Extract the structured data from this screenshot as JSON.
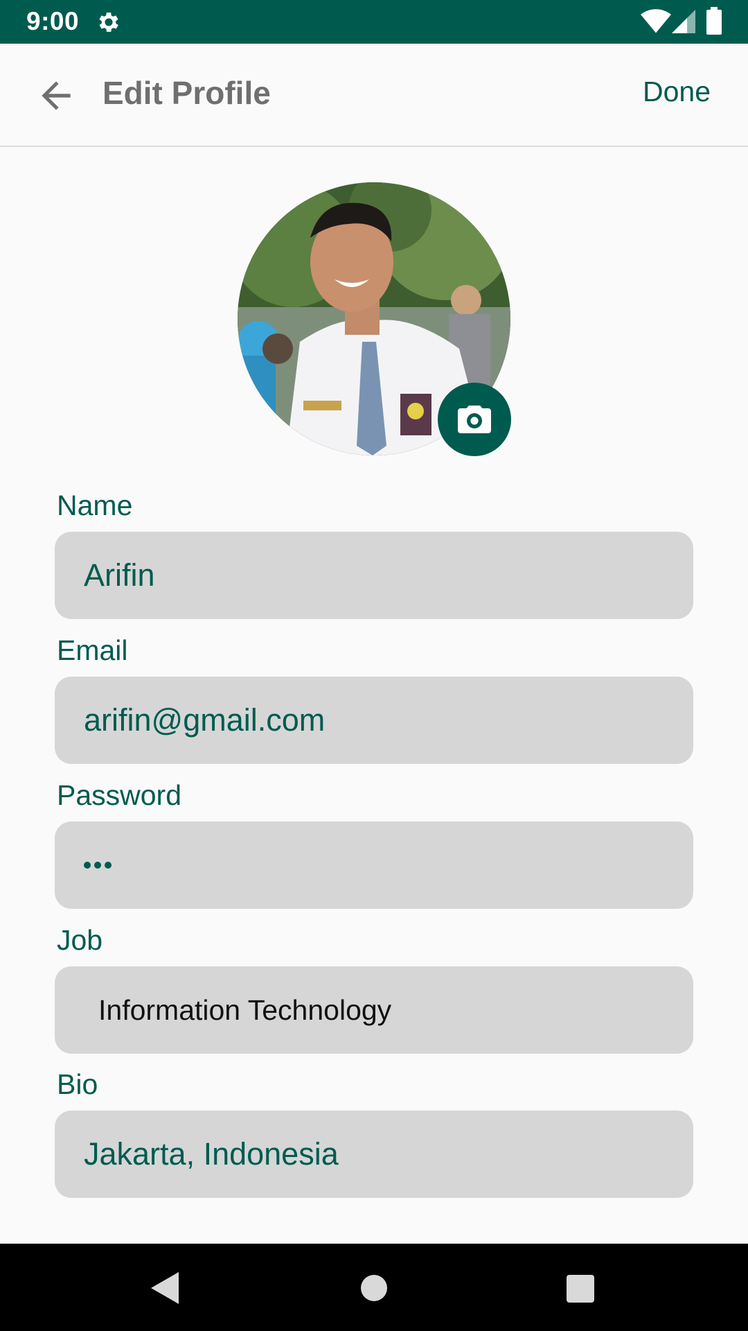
{
  "status_bar": {
    "time": "9:00",
    "icons": [
      "gear-icon",
      "wifi-icon",
      "signal-icon",
      "battery-icon"
    ]
  },
  "app_bar": {
    "back_icon": "arrow-left-icon",
    "title": "Edit Profile",
    "done_label": "Done"
  },
  "profile": {
    "camera_icon": "camera-icon"
  },
  "form": {
    "name": {
      "label": "Name",
      "value": "Arifin"
    },
    "email": {
      "label": "Email",
      "value": "arifin@gmail.com"
    },
    "password": {
      "label": "Password",
      "masked_length": 3
    },
    "job": {
      "label": "Job",
      "value": "Information Technology"
    },
    "bio": {
      "label": "Bio",
      "value": "Jakarta, Indonesia"
    }
  },
  "nav_bar": {
    "icons": [
      "back-triangle-icon",
      "home-circle-icon",
      "recents-square-icon"
    ]
  },
  "colors": {
    "primary": "#005b4f",
    "field_bg": "#d6d6d6",
    "page_bg": "#fafafa"
  }
}
